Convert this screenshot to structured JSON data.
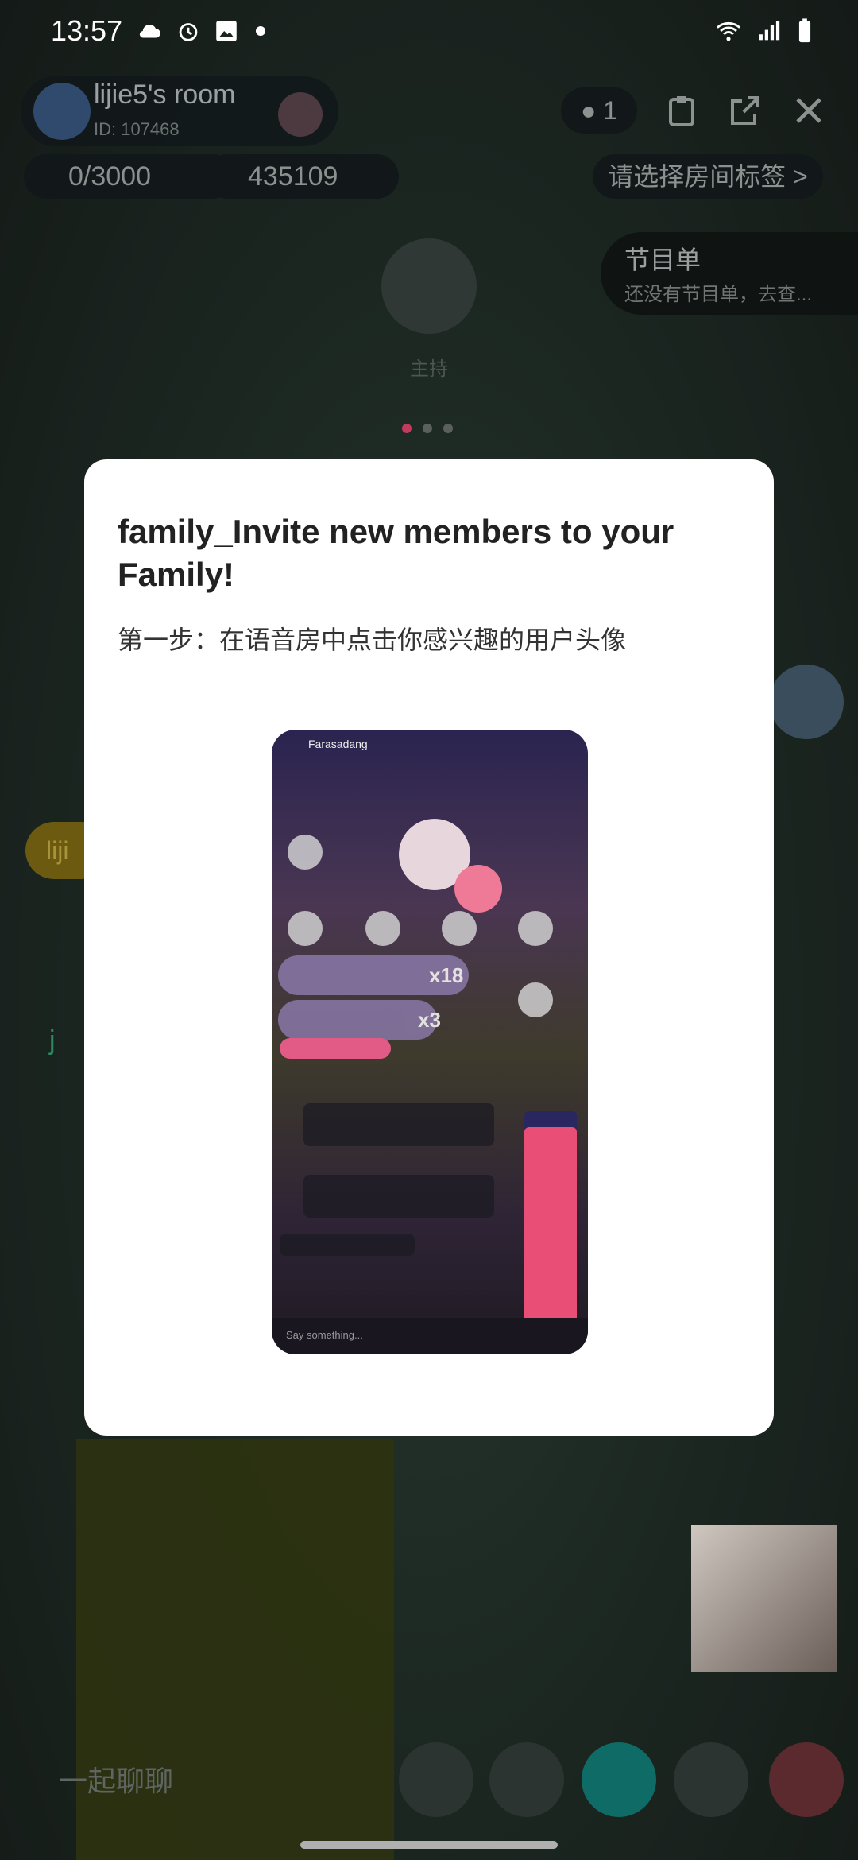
{
  "status_bar": {
    "time": "13:57"
  },
  "room": {
    "name": "lijie5's room",
    "id_text": "ID: 107468",
    "user_count": "1",
    "hot_value": "0/3000",
    "star_value": "435109",
    "tag_placeholder": "请选择房间标签 >",
    "program_title": "节目单",
    "program_subtitle": "还没有节目单，去查...",
    "host_label": "主持",
    "side_bubble_text": "liji",
    "chat_left_char": "j",
    "chat_placeholder": "一起聊聊"
  },
  "modal": {
    "title": "family_Invite new members to your Family!",
    "step_text": "第一步：在语音房中点击你感兴趣的用户头像",
    "preview": {
      "room_name": "Farasadang",
      "gift1_count": "x18",
      "gift2_count": "x3",
      "chat_placeholder": "Say something..."
    }
  },
  "colors": {
    "accent_pink": "#c23b5d",
    "modal_bg": "#ffffff"
  }
}
